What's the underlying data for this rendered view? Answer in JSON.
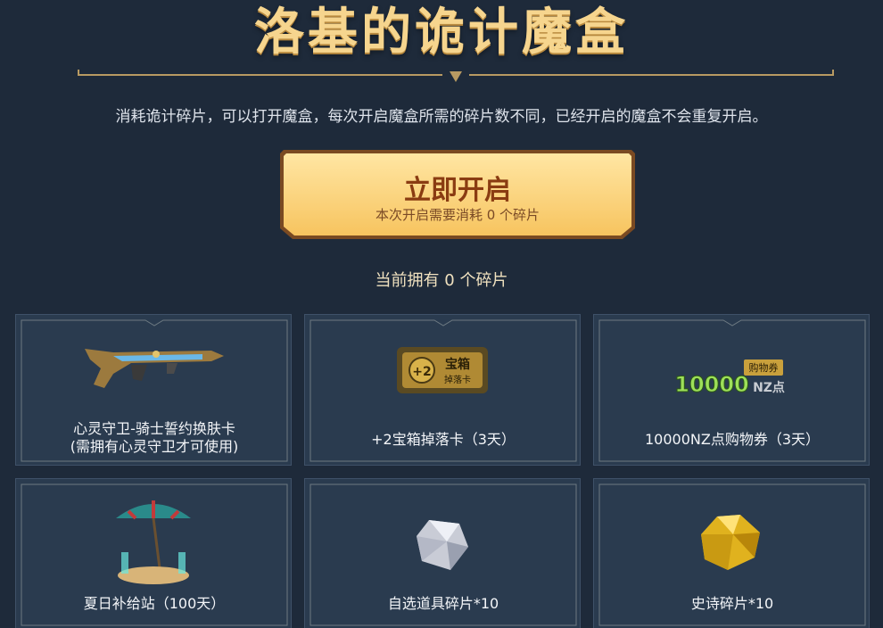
{
  "header": {
    "title": "洛基的诡计魔盒",
    "subtitle": "消耗诡计碎片，可以打开魔盒，每次开启魔盒所需的碎片数不同，已经开启的魔盒不会重复开启。"
  },
  "open_button": {
    "label": "立即开启",
    "cost_text": "本次开启需要消耗 0 个碎片"
  },
  "owned_text": "当前拥有 0 个碎片",
  "colors": {
    "background": "#1e2a3a",
    "card": "#2a3b4f",
    "gold": "#f6d58e",
    "button": "#fbd377"
  },
  "rewards": [
    {
      "label": "心灵守卫-骑士誓约换肤卡\n(需拥有心灵守卫才可使用)",
      "line1": "心灵守卫-骑士誓约换肤卡",
      "line2": "(需拥有心灵守卫才可使用)",
      "icon": "rifle-icon"
    },
    {
      "line1": "+2宝箱掉落卡（3天）",
      "icon": "chest-drop-card-icon",
      "card_text": "宝箱",
      "card_sub": "掉落卡",
      "card_plus": "+2"
    },
    {
      "line1": "10000NZ点购物券（3天）",
      "icon": "nz-voucher-icon",
      "voucher_amount": "10000",
      "voucher_unit": "NZ点",
      "voucher_tag": "购物券"
    },
    {
      "line1": "夏日补给站（100天）",
      "icon": "beach-umbrella-icon"
    },
    {
      "line1": "自选道具碎片*10",
      "icon": "silver-crystal-icon"
    },
    {
      "line1": "史诗碎片*10",
      "icon": "gold-crystal-icon"
    }
  ]
}
